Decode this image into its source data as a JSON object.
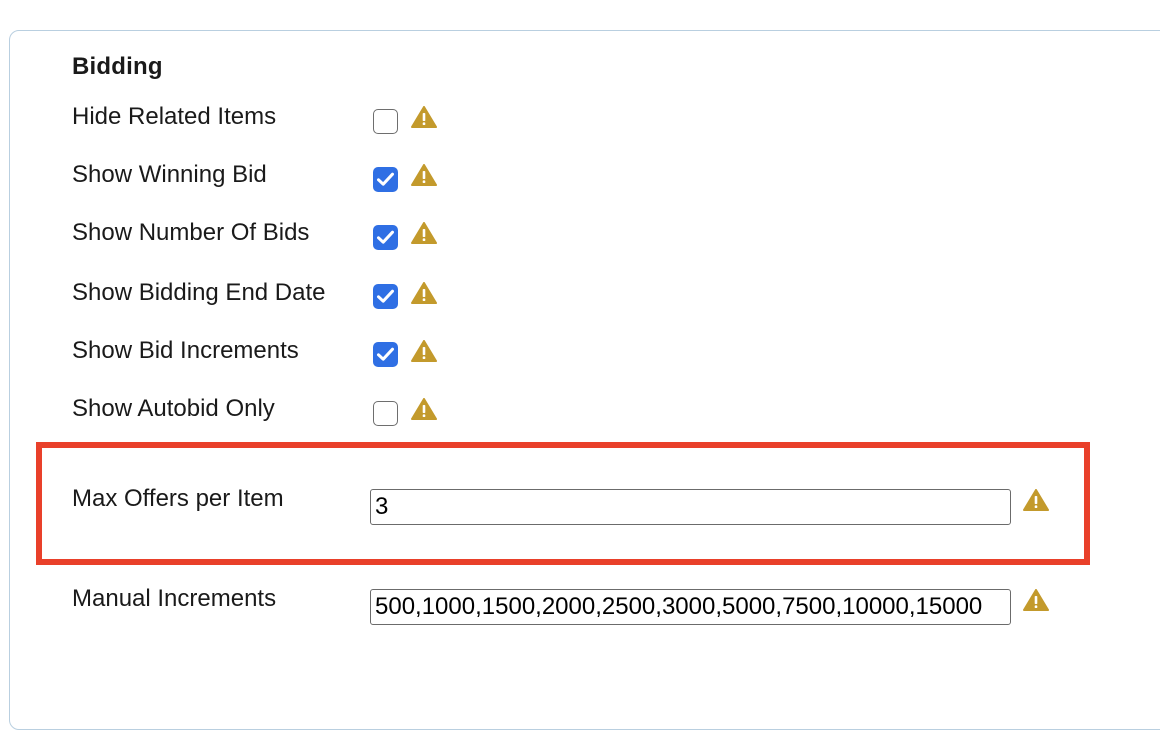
{
  "section": {
    "title": "Bidding"
  },
  "settings": [
    {
      "label": "Hide Related Items",
      "checked": false
    },
    {
      "label": "Show Winning Bid",
      "checked": true
    },
    {
      "label": "Show Number Of Bids",
      "checked": true
    },
    {
      "label": "Show Bidding End Date",
      "checked": true
    },
    {
      "label": "Show Bid Increments",
      "checked": true
    },
    {
      "label": "Show Autobid Only",
      "checked": false
    }
  ],
  "max_offers": {
    "label": "Max Offers per Item",
    "value": "3"
  },
  "manual_increments": {
    "label": "Manual Increments",
    "value": "500,1000,1500,2000,2500,3000,5000,7500,10000,15000"
  },
  "icons": {
    "warning": "warning-triangle-icon",
    "check": "checkmark-icon"
  },
  "colors": {
    "checkbox_checked": "#2f6fe4",
    "warning": "#c39a2c",
    "highlight": "#e9402a",
    "panel_border": "#b9cfe0"
  }
}
